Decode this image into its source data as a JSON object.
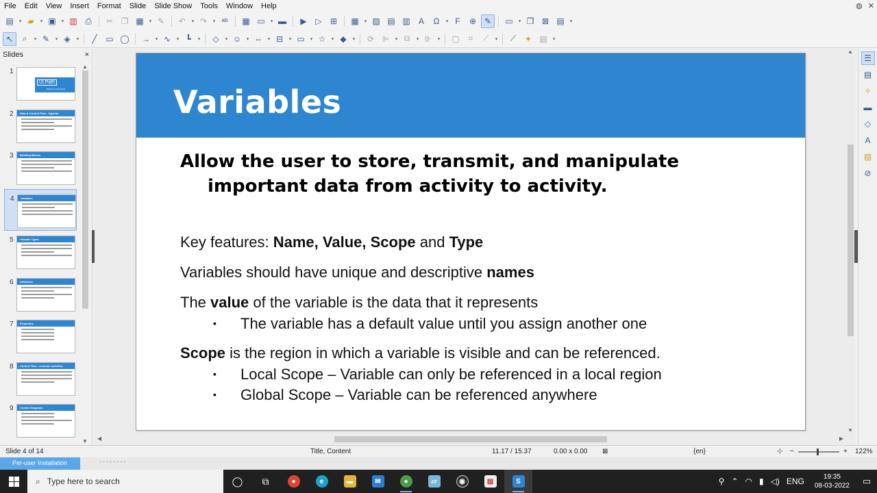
{
  "menu": {
    "items": [
      "File",
      "Edit",
      "View",
      "Insert",
      "Format",
      "Slide",
      "Slide Show",
      "Tools",
      "Window",
      "Help"
    ]
  },
  "slides_pane": {
    "title": "Slides",
    "close": "×",
    "thumbnails": [
      {
        "num": "1",
        "title": "",
        "logo": "Ui Path",
        "sub": "Data & Control Flow"
      },
      {
        "num": "2",
        "title": "Data & Control Flow - Agenda"
      },
      {
        "num": "3",
        "title": "Building Blocks"
      },
      {
        "num": "4",
        "title": "Variables"
      },
      {
        "num": "5",
        "title": "Variable Types"
      },
      {
        "num": "6",
        "title": "Attributes"
      },
      {
        "num": "7",
        "title": "Properties"
      },
      {
        "num": "8",
        "title": "Control Flow - common activities"
      },
      {
        "num": "9",
        "title": "Control Diagrams"
      }
    ]
  },
  "slide": {
    "title": "Variables",
    "subtitle_line1": "Allow the user to store, transmit, and manipulate",
    "subtitle_line2": "important data from activity to activity.",
    "p1_a": "Key features: ",
    "p1_b": "Name, Value, Scope",
    "p1_c": " and ",
    "p1_d": "Type",
    "p2_a": "Variables should have unique and descriptive ",
    "p2_b": "names",
    "p3_a": "The ",
    "p3_b": "value",
    "p3_c": " of the variable is the data that it represents",
    "b1": "The variable has a default value until you assign another one",
    "p4_a": "Scope",
    "p4_b": " is the region in which a variable is visible and can be referenced.",
    "b2": "Local Scope – Variable can only be referenced in a local region",
    "b3": "Global Scope – Variable can be referenced anywhere"
  },
  "statusbar": {
    "slide_pos": "Slide 4 of 14",
    "layout": "Title, Content",
    "position": "11.17 / 15.37",
    "size": "0.00 x 0.00",
    "lang": "{en}",
    "zoom_minus": "−",
    "zoom_plus": "+",
    "zoom": "122%"
  },
  "install": {
    "label": "Per-user Installation"
  },
  "taskbar": {
    "search_placeholder": "Type here to search",
    "lang": "ENG",
    "time": "19:35",
    "date": "08-03-2022"
  }
}
